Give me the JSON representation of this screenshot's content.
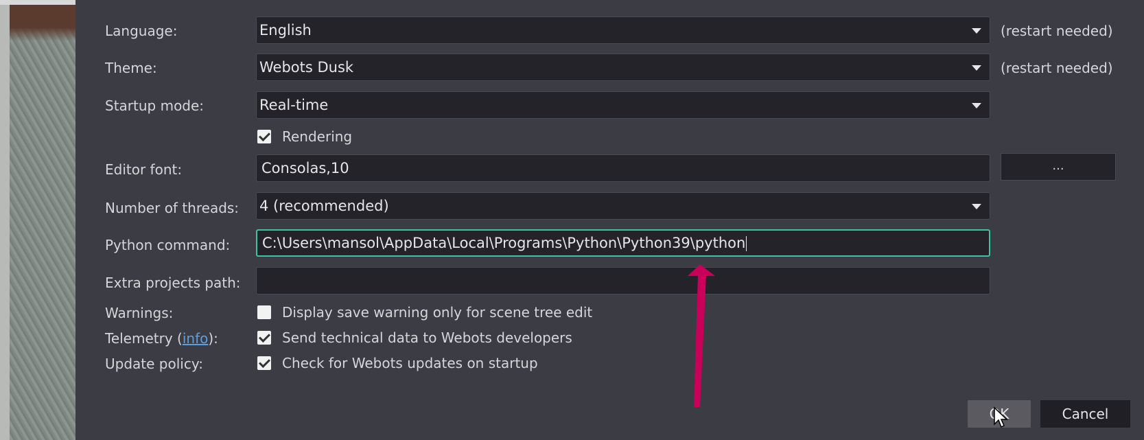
{
  "labels": {
    "language": "Language:",
    "theme": "Theme:",
    "startup_mode": "Startup mode:",
    "editor_font": "Editor font:",
    "threads": "Number of threads:",
    "python_command": "Python command:",
    "extra_projects_path": "Extra projects path:",
    "warnings": "Warnings:",
    "telemetry_prefix": "Telemetry (",
    "telemetry_link": "info",
    "telemetry_suffix": "):",
    "update_policy": "Update policy:"
  },
  "fields": {
    "language": "English",
    "theme": "Webots Dusk",
    "startup_mode": "Real-time",
    "editor_font": "Consolas,10",
    "threads": "4 (recommended)",
    "python_command": "C:\\Users\\mansol\\AppData\\Local\\Programs\\Python\\Python39\\python",
    "extra_projects_path": ""
  },
  "notes": {
    "language": "(restart needed)",
    "theme": "(restart needed)"
  },
  "checkboxes": {
    "rendering": {
      "label": "Rendering",
      "checked": true
    },
    "warnings": {
      "label": "Display save warning only for scene tree edit",
      "checked": false
    },
    "telemetry": {
      "label": "Send technical data to Webots developers",
      "checked": true
    },
    "updates": {
      "label": "Check for Webots updates on startup",
      "checked": true
    }
  },
  "buttons": {
    "font_picker": "...",
    "ok": "OK",
    "cancel": "Cancel"
  },
  "colors": {
    "focus_border": "#38c4a3",
    "annotation_arrow": "#c8005a",
    "link": "#5a9fe0"
  }
}
